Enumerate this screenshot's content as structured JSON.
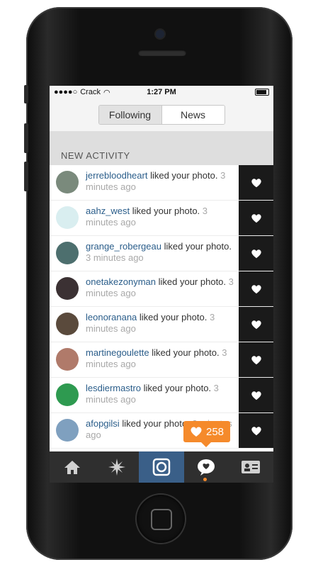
{
  "status_bar": {
    "carrier": "Crack",
    "time": "1:27 PM"
  },
  "segments": {
    "following": "Following",
    "news": "News"
  },
  "section_title": "NEW ACTIVITY",
  "activities": [
    {
      "user": "jerrebloodheart",
      "action": " liked your photo.",
      "time": "3 minutes ago",
      "avatar_color": "#7a8a7c"
    },
    {
      "user": "aahz_west",
      "action": " liked your photo.",
      "time": "3 minutes ago",
      "avatar_color": "#d9eef0"
    },
    {
      "user": "grange_robergeau",
      "action": " liked your photo.",
      "time": "3 minutes ago",
      "avatar_color": "#4d6f6e"
    },
    {
      "user": "onetakezonyman",
      "action": " liked your photo.",
      "time": "3 minutes ago",
      "avatar_color": "#3b3133"
    },
    {
      "user": "leonoranana",
      "action": " liked your photo.",
      "time": "3 minutes ago",
      "avatar_color": "#5a4a3c"
    },
    {
      "user": "martinegoulette",
      "action": " liked your photo.",
      "time": "3 minutes ago",
      "avatar_color": "#b07a6a"
    },
    {
      "user": "lesdiermastro",
      "action": " liked your photo.",
      "time": "3 minutes ago",
      "avatar_color": "#2e9a50"
    },
    {
      "user": "afopgilsi",
      "action": " liked your photo.",
      "time": "3 minutes ago",
      "avatar_color": "#7fa0bf"
    }
  ],
  "tabs": [
    {
      "icon": "home-icon"
    },
    {
      "icon": "explore-icon"
    },
    {
      "icon": "camera-icon"
    },
    {
      "icon": "news-icon"
    },
    {
      "icon": "profile-icon"
    }
  ],
  "badge": {
    "count": "258"
  },
  "colors": {
    "accent": "#3a5f88",
    "badge": "#f58a2b",
    "username": "#2a5d8a"
  }
}
